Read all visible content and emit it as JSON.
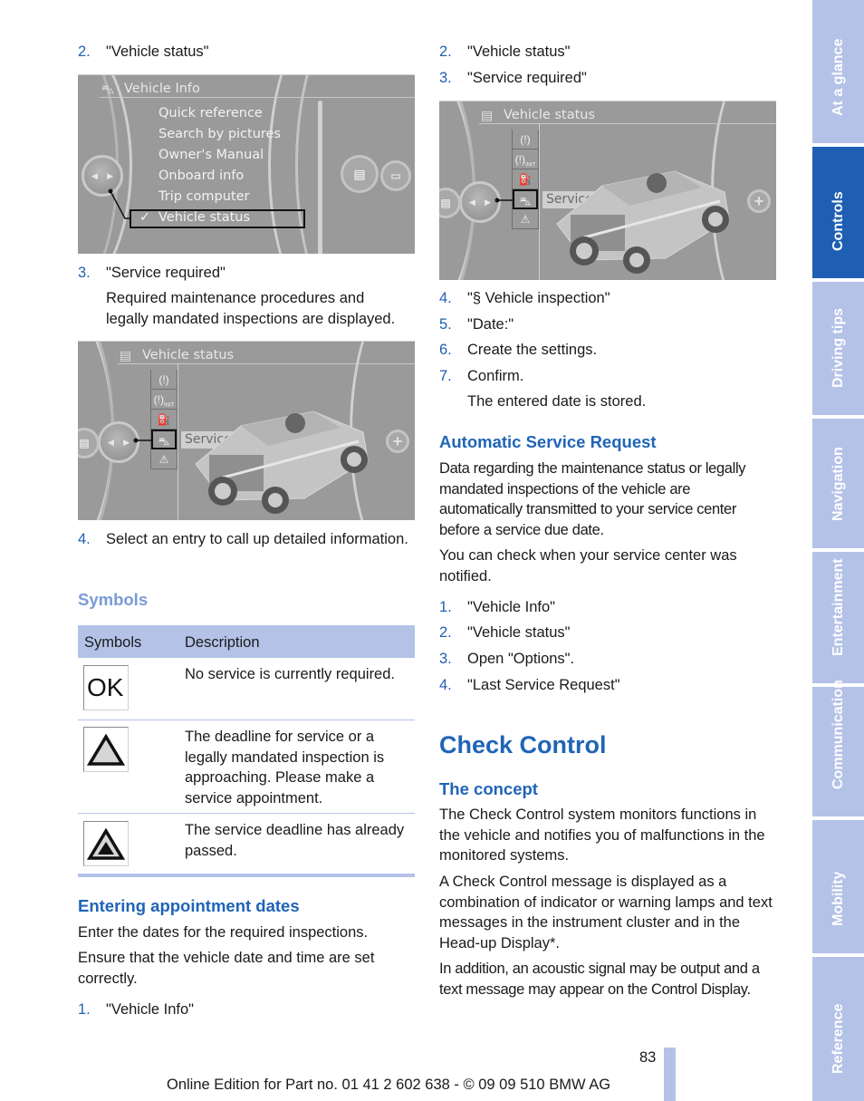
{
  "left_column": {
    "step_2": {
      "num": "2.",
      "text": "\"Vehicle status\""
    },
    "screen_1": {
      "title": "Vehicle Info",
      "menu_items": [
        "Quick reference",
        "Search by pictures",
        "Owner's Manual",
        "Onboard info",
        "Trip computer",
        "Vehicle status"
      ],
      "selected_index": 5,
      "check_mark": "✓"
    },
    "step_3": {
      "num": "3.",
      "text": "\"Service required\""
    },
    "step_3_note": "Required maintenance procedures and legally mandated inspections are displayed.",
    "screen_2": {
      "title": "Vehicle status",
      "highlight_label": "Service required"
    },
    "step_4": {
      "num": "4.",
      "text": "Select an entry to call up detailed information."
    },
    "symbols_heading": "Symbols",
    "symbols_table": {
      "headers": [
        "Symbols",
        "Description"
      ],
      "rows": [
        {
          "symbol": "OK",
          "icon": "ok-icon",
          "description": "No service is currently required."
        },
        {
          "symbol": "△",
          "icon": "warning-triangle-icon",
          "description": "The deadline for service or a legally mandated inspection is approaching. Please make a service appointment."
        },
        {
          "symbol": "▲",
          "icon": "overdue-triangle-icon",
          "description": "The service deadline has already passed."
        }
      ]
    },
    "appointment_heading": "Entering appointment dates",
    "appointment_p1": "Enter the dates for the required inspections.",
    "appointment_p2": "Ensure that the vehicle date and time are set correctly.",
    "appointment_step_1": {
      "num": "1.",
      "text": "\"Vehicle Info\""
    }
  },
  "right_column": {
    "steps_a": [
      {
        "num": "2.",
        "text": "\"Vehicle status\""
      },
      {
        "num": "3.",
        "text": "\"Service required\""
      }
    ],
    "screen_3": {
      "title": "Vehicle status",
      "highlight_label": "Service required"
    },
    "steps_b": [
      {
        "num": "4.",
        "text": "\"§ Vehicle inspection\""
      },
      {
        "num": "5.",
        "text": "\"Date:\""
      },
      {
        "num": "6.",
        "text": "Create the settings."
      },
      {
        "num": "7.",
        "text": "Confirm."
      }
    ],
    "step_7_note": "The entered date is stored.",
    "auto_heading": "Automatic Service Request",
    "auto_p1": "Data regarding the maintenance status or legally mandated inspections of the vehicle are automatically transmitted to your service center before a service due date.",
    "auto_p2": "You can check when your service center was notified.",
    "steps_c": [
      {
        "num": "1.",
        "text": "\"Vehicle Info\""
      },
      {
        "num": "2.",
        "text": "\"Vehicle status\""
      },
      {
        "num": "3.",
        "text": "Open \"Options\"."
      },
      {
        "num": "4.",
        "text": "\"Last Service Request\""
      }
    ],
    "check_control_heading": "Check Control",
    "concept_heading": "The concept",
    "concept_p1": "The Check Control system monitors functions in the vehicle and notifies you of malfunctions in the monitored systems.",
    "concept_p2": "A Check Control message is displayed as a combination of indicator or warning lamps and text messages in the instrument cluster and in the Head-up Display*.",
    "concept_p3": "In addition, an acoustic signal may be output and a text message may appear on the Control Display."
  },
  "side_tabs": [
    {
      "label": "At a glance",
      "active": false
    },
    {
      "label": "Controls",
      "active": true
    },
    {
      "label": "Driving tips",
      "active": false
    },
    {
      "label": "Navigation",
      "active": false
    },
    {
      "label": "Entertainment",
      "active": false
    },
    {
      "label": "Communication",
      "active": false
    },
    {
      "label": "Mobility",
      "active": false
    },
    {
      "label": "Reference",
      "active": false
    }
  ],
  "footer": {
    "page_number": "83",
    "text": "Online Edition for Part no. 01 41 2 602 638 - © 09 09 510 BMW AG"
  },
  "colors": {
    "accent_blue": "#1f5fb3",
    "tab_light": "#b3c2e6",
    "heading_light": "#7a9ad8"
  }
}
